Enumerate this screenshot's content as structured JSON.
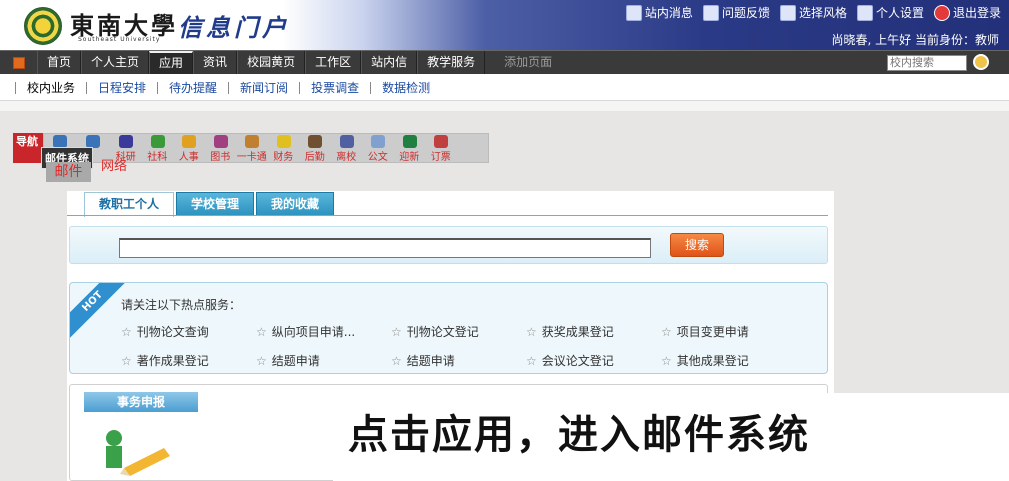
{
  "header": {
    "logo_cn": "東南大學",
    "logo_en": "Southeast University",
    "portal_title": "信息门户",
    "top_links": [
      {
        "label": "站内消息",
        "icon": "message-icon"
      },
      {
        "label": "问题反馈",
        "icon": "feedback-icon"
      },
      {
        "label": "选择风格",
        "icon": "style-icon"
      },
      {
        "label": "个人设置",
        "icon": "user-settings-icon"
      },
      {
        "label": "退出登录",
        "icon": "logout-icon"
      }
    ],
    "greeting": "尚晓春, 上午好 当前身份：教师"
  },
  "nav": {
    "tabs": [
      "首页",
      "个人主页",
      "应用",
      "资讯",
      "校园黄页",
      "工作区",
      "站内信",
      "教学服务"
    ],
    "active_tab": "应用",
    "add_page": "添加页面",
    "search_placeholder": "校内搜索"
  },
  "subnav": {
    "items": [
      "校内业务",
      "日程安排",
      "待办提醒",
      "新闻订阅",
      "投票调查",
      "数据检测"
    ],
    "active": "校内业务"
  },
  "app_strip": {
    "badge": "导航",
    "items": [
      "邮件",
      "网络",
      "科研",
      "社科",
      "人事",
      "图书",
      "一卡通",
      "财务",
      "后勤",
      "离校",
      "公文",
      "迎新",
      "订票"
    ],
    "tooltip": "邮件系统",
    "hover_label": "邮件",
    "hover_label_2": "网络"
  },
  "panel": {
    "tabs": [
      "教职工个人",
      "学校管理",
      "我的收藏"
    ],
    "active_tab": "教职工个人",
    "search_button": "搜索",
    "hot_badge": "HOT",
    "hot_intro": "请关注以下热点服务：",
    "hot_items": [
      "刊物论文查询",
      "纵向项目申请...",
      "刊物论文登记",
      "获奖成果登记",
      "项目变更申请",
      "著作成果登记",
      "结题申请",
      "结题申请",
      "会议论文登记",
      "其他成果登记"
    ],
    "affairs_title": "事务申报"
  },
  "caption": "点击应用，进入邮件系统"
}
